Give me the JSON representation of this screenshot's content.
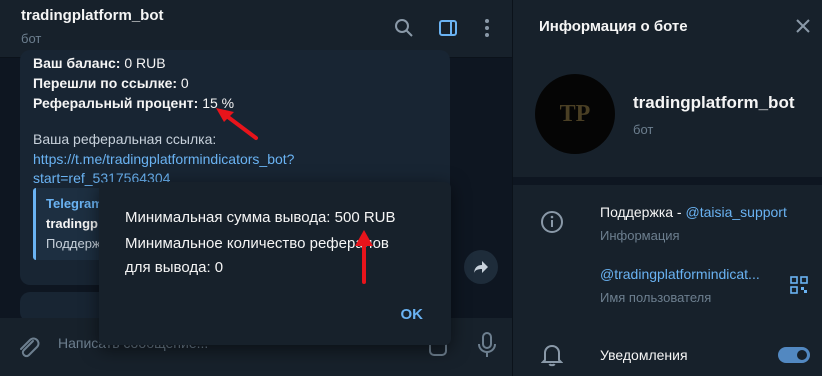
{
  "chat": {
    "title": "tradingplatform_bot",
    "subtitle": "бот",
    "message": {
      "balance_label": "Ваш баланс:",
      "balance_value": "0 RUB",
      "referrals_label": "Перешли по ссылке:",
      "referrals_value": "0",
      "percent_label": "Реферальный процент:",
      "percent_value": "15 %",
      "link_label": "Ваша реферальная ссылка:",
      "link_line1": "https://t.me/tradingplatformindicators_bot?",
      "link_line2": "start=ref_5317564304",
      "quote_title": "Telegram",
      "quote_name": "tradingp",
      "quote_text": "Поддерж"
    },
    "composer_placeholder": "Написать сообщение..."
  },
  "panel": {
    "title": "Информация о боте",
    "avatar_initials": "TP",
    "bot_name": "tradingplatform_bot",
    "bot_sub": "бот",
    "support_prefix": "Поддержка - ",
    "support_link": "@taisia_support",
    "support_caption": "Информация",
    "username": "@tradingplatformindicat...",
    "username_caption": "Имя пользователя",
    "notifications": "Уведомления",
    "notifications_on": true
  },
  "modal": {
    "line1": "Минимальная сумма вывода: 500 RUB",
    "line2": "Минимальное количество рефералов",
    "line3": "для вывода: 0",
    "ok": "OK"
  },
  "colors": {
    "accent": "#6ab3f3",
    "annotation_arrow": "#e8141b"
  }
}
